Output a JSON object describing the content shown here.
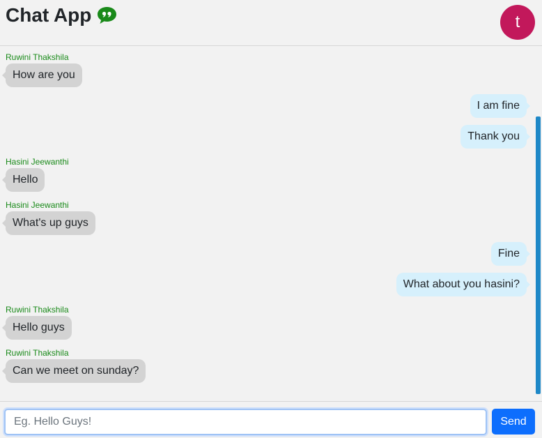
{
  "header": {
    "title": "Chat App",
    "icon": "quote-chat-icon",
    "avatar_letter": "t",
    "avatar_color": "#c2185b"
  },
  "messages": [
    {
      "sender": "Ruwini Thakshila",
      "text": "How are you",
      "direction": "in"
    },
    {
      "sender": "",
      "text": "I am fine",
      "direction": "out"
    },
    {
      "sender": "",
      "text": "Thank you",
      "direction": "out"
    },
    {
      "sender": "Hasini Jeewanthi",
      "text": "Hello",
      "direction": "in"
    },
    {
      "sender": "Hasini Jeewanthi",
      "text": "What's up guys",
      "direction": "in"
    },
    {
      "sender": "",
      "text": "Fine",
      "direction": "out"
    },
    {
      "sender": "",
      "text": "What about you hasini?",
      "direction": "out"
    },
    {
      "sender": "Ruwini Thakshila",
      "text": "Hello guys",
      "direction": "in"
    },
    {
      "sender": "Ruwini Thakshila",
      "text": "Can we meet on sunday?",
      "direction": "in"
    }
  ],
  "composer": {
    "placeholder": "Eg. Hello Guys!",
    "value": "",
    "send_label": "Send"
  },
  "colors": {
    "incoming_bubble": "#d3d3d3",
    "outgoing_bubble": "#d6f0fc",
    "sender_name": "#1a8a1a",
    "send_button": "#0d6efd",
    "scrollbar": "#1e88c7"
  }
}
